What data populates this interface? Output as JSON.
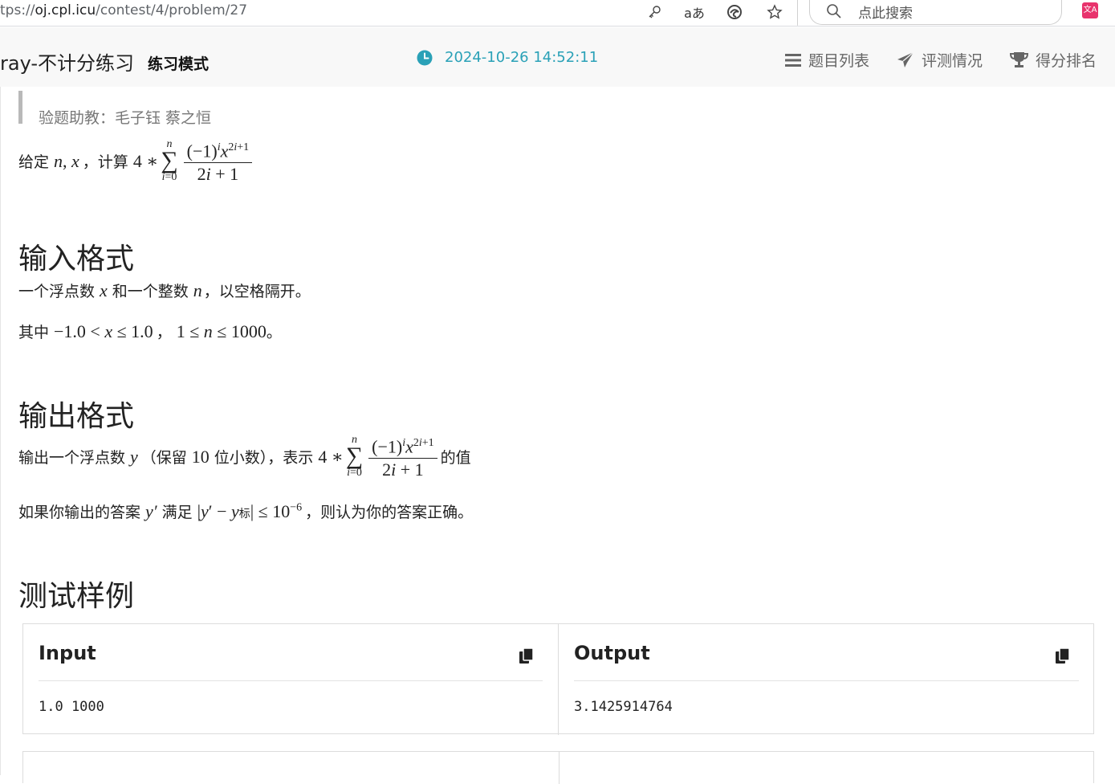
{
  "browser": {
    "url_prefix": "tps://",
    "url_host": "oj.cpl.icu",
    "url_path": "/contest/4/problem/27",
    "search_placeholder": "点此搜索"
  },
  "header": {
    "contest_title": "ray-不计分练习",
    "mode_badge": "练习模式",
    "clock_time": "2024-10-26 14:52:11",
    "nav": {
      "problem_list": "题目列表",
      "judge_status": "评测情况",
      "ranking": "得分排名"
    }
  },
  "problem": {
    "reviewers": "验题助教：毛子钰 蔡之恒",
    "statement_prefix": "给定",
    "statement_compute": "计算",
    "input_heading": "输入格式",
    "input_line1_a": "一个浮点数",
    "input_line1_b": "和一个整数",
    "input_line1_c": "，以空格隔开。",
    "input_line2_a": "其中",
    "output_heading": "输出格式",
    "output_line1_a": "输出一个浮点数",
    "output_line1_b": "（保留",
    "output_line1_c": "位小数），表示",
    "output_line1_d": "的值",
    "output_line2_a": "如果你输出的答案",
    "output_line2_b": "满足",
    "output_line2_c": "，则认为你的答案正确。",
    "samples_heading": "测试样例"
  },
  "samples": [
    {
      "input_label": "Input",
      "input": "1.0 1000",
      "output_label": "Output",
      "output": "3.1425914764"
    }
  ],
  "colors": {
    "accent": "#2aa1b7",
    "nav": "#666666",
    "header_bg": "#f8f8f8"
  }
}
